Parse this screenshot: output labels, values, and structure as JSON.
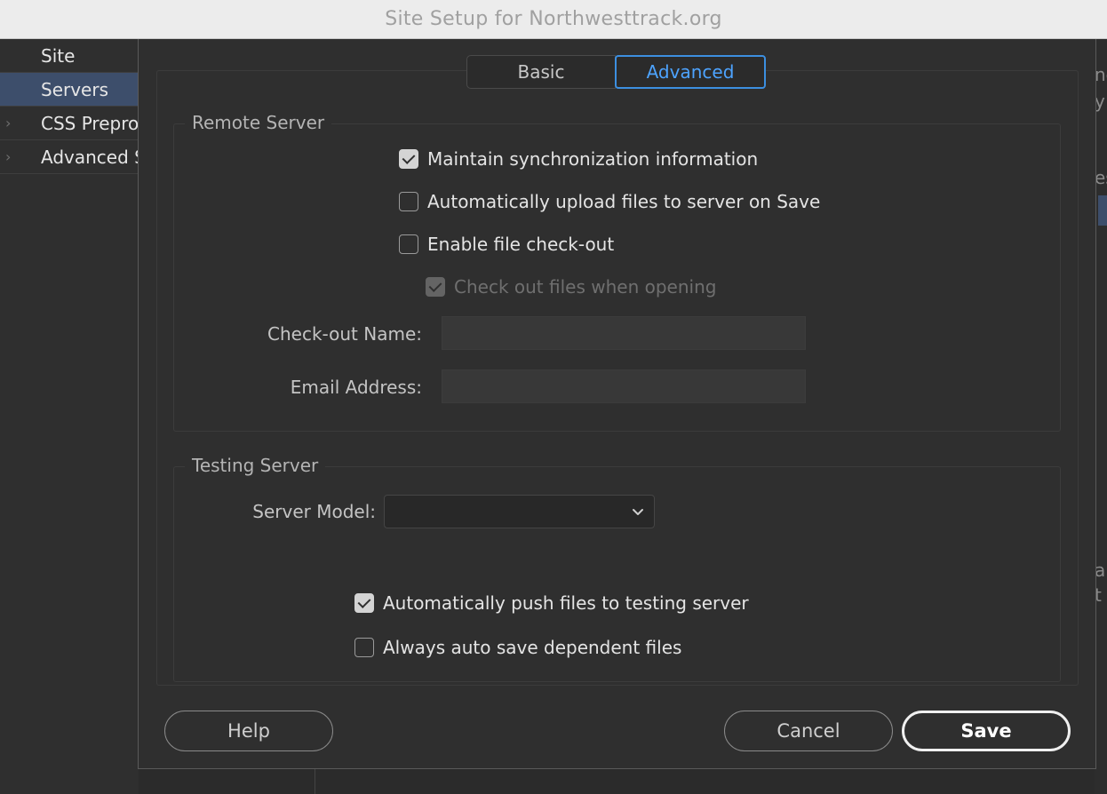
{
  "window": {
    "title": "Site Setup for Northwesttrack.org"
  },
  "sidebar": {
    "items": [
      {
        "label": "Site",
        "has_chevron": false,
        "selected": false
      },
      {
        "label": "Servers",
        "has_chevron": false,
        "selected": true
      },
      {
        "label": "CSS Preprocessors",
        "has_chevron": true,
        "selected": false
      },
      {
        "label": "Advanced Settings",
        "has_chevron": true,
        "selected": false
      }
    ]
  },
  "background_fragments": {
    "right_text": [
      "ne",
      "y",
      "es",
      "ab",
      "t"
    ]
  },
  "tabs": {
    "basic_label": "Basic",
    "advanced_label": "Advanced",
    "active": "Advanced"
  },
  "remote_server": {
    "title": "Remote Server",
    "maintain_sync": {
      "label": "Maintain synchronization information",
      "checked": true
    },
    "auto_upload": {
      "label": "Automatically upload files to server on Save",
      "checked": false
    },
    "enable_checkout": {
      "label": "Enable file check-out",
      "checked": false
    },
    "checkout_when_opening": {
      "label": "Check out files when opening",
      "checked": true,
      "disabled": true
    },
    "checkout_name": {
      "label": "Check-out Name:",
      "value": ""
    },
    "email_address": {
      "label": "Email Address:",
      "value": ""
    }
  },
  "testing_server": {
    "title": "Testing Server",
    "server_model": {
      "label": "Server Model:",
      "value": ""
    },
    "auto_push": {
      "label": "Automatically push files to testing server",
      "checked": true
    },
    "auto_save_dependent": {
      "label": "Always auto save dependent files",
      "checked": false
    }
  },
  "footer": {
    "help_label": "Help",
    "cancel_label": "Cancel",
    "save_label": "Save"
  },
  "colors": {
    "accent": "#3c8fe0",
    "selection": "#3d4e6b",
    "dialog_bg": "#2f2f2f"
  }
}
